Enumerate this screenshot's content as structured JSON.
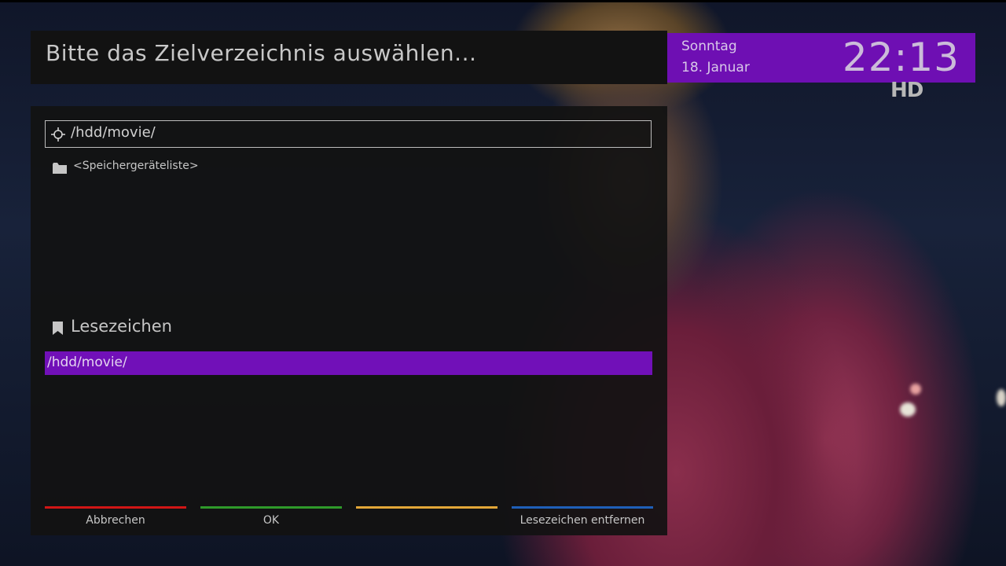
{
  "header": {
    "title": "Bitte das Zielverzeichnis auswählen..."
  },
  "clock": {
    "day": "Sonntag",
    "date": "18. Januar",
    "time": "22:13",
    "badge": "HD",
    "accent_color": "#6e0fb3"
  },
  "browser": {
    "current_path": "/hdd/movie/",
    "entries": [
      {
        "label": "<Speichergeräteliste>",
        "icon": "folder-icon"
      }
    ]
  },
  "bookmarks": {
    "title": "Lesezeichen",
    "items": [
      {
        "label": "/hdd/movie/",
        "selected": true
      }
    ]
  },
  "color_keys": [
    {
      "label": "Abbrechen",
      "color": "#d01616"
    },
    {
      "label": "OK",
      "color": "#2f9a2a"
    },
    {
      "label": "",
      "color": "#e2a638"
    },
    {
      "label": "Lesezeichen entfernen",
      "color": "#1f5fb8"
    }
  ]
}
